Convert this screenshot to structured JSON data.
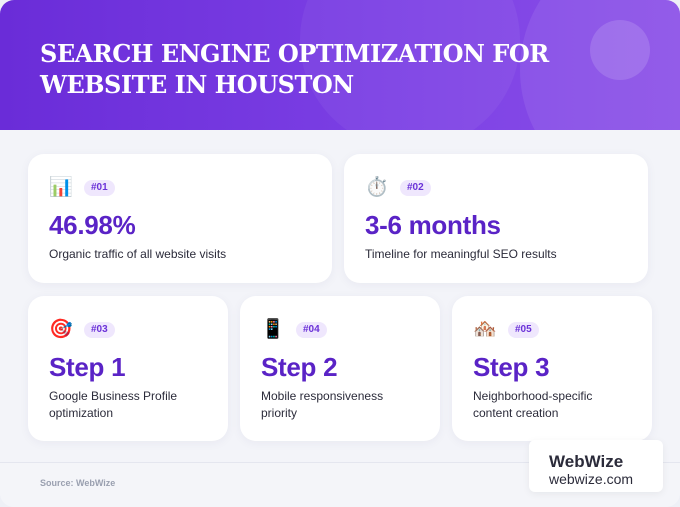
{
  "title": "SEARCH ENGINE OPTIMIZATION FOR WEBSITE IN HOUSTON",
  "cards": [
    {
      "icon": "📊",
      "icon_name": "bar-chart-icon",
      "badge": "#01",
      "value": "46.98%",
      "desc": "Organic traffic of all website visits"
    },
    {
      "icon": "⏱️",
      "icon_name": "stopwatch-icon",
      "badge": "#02",
      "value": "3-6 months",
      "desc": "Timeline for meaningful SEO results"
    },
    {
      "icon": "🎯",
      "icon_name": "target-icon",
      "badge": "#03",
      "value": "Step 1",
      "desc": "Google Business Profile optimization"
    },
    {
      "icon": "📱",
      "icon_name": "mobile-phone-icon",
      "badge": "#04",
      "value": "Step 2",
      "desc": "Mobile responsiveness priority"
    },
    {
      "icon": "🏘️",
      "icon_name": "houses-icon",
      "badge": "#05",
      "value": "Step 3",
      "desc": "Neighborhood-specific content creation"
    }
  ],
  "footer": {
    "source": "Source: WebWize",
    "brand_name": "WebWize",
    "brand_url": "webwize.com"
  },
  "colors": {
    "header": "#6a2cd8",
    "accent": "#5a23c6",
    "badge_bg": "#efe7fd"
  }
}
